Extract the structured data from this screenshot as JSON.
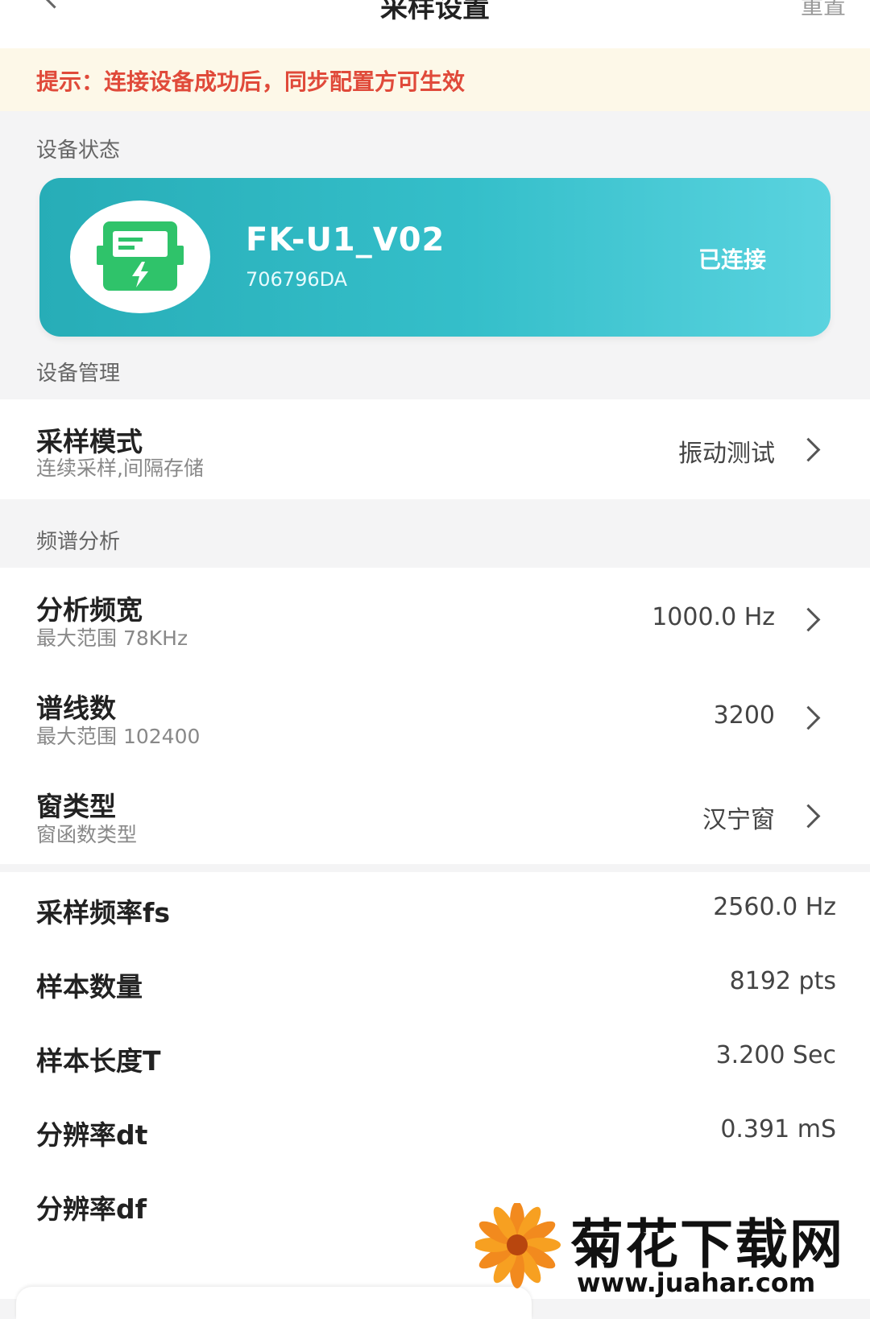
{
  "header": {
    "title": "采样设置",
    "action_label": "重置"
  },
  "tip": {
    "text": "提示：连接设备成功后，同步配置方可生效"
  },
  "device_status": {
    "section_label": "设备状态",
    "name": "FK-U1_V02",
    "id": "706796DA",
    "status": "已连接",
    "icon": "meter-icon",
    "card_color": "#2fb6c1",
    "icon_color": "#2fc36a"
  },
  "device_management": {
    "section_label": "设备管理",
    "sampling_mode": {
      "title": "采样模式",
      "subtitle": "连续采样,间隔存储",
      "value": "振动测试"
    }
  },
  "spectrum": {
    "section_label": "频谱分析",
    "items": [
      {
        "title": "分析频宽",
        "subtitle": "最大范围 78KHz",
        "value": "1000.0 Hz"
      },
      {
        "title": "谱线数",
        "subtitle": "最大范围 102400",
        "value": "3200"
      },
      {
        "title": "窗类型",
        "subtitle": "窗函数类型",
        "value": "汉宁窗"
      }
    ]
  },
  "computed": {
    "items": [
      {
        "title": "采样频率fs",
        "value": "2560.0 Hz"
      },
      {
        "title": "样本数量",
        "value": "8192 pts"
      },
      {
        "title": "样本长度T",
        "value": "3.200 Sec"
      },
      {
        "title": "分辨率dt",
        "value": "0.391 mS"
      },
      {
        "title": "分辨率df",
        "value": ""
      }
    ]
  },
  "watermark": {
    "text": "菊花下载网",
    "url": "www.juahar.com"
  }
}
